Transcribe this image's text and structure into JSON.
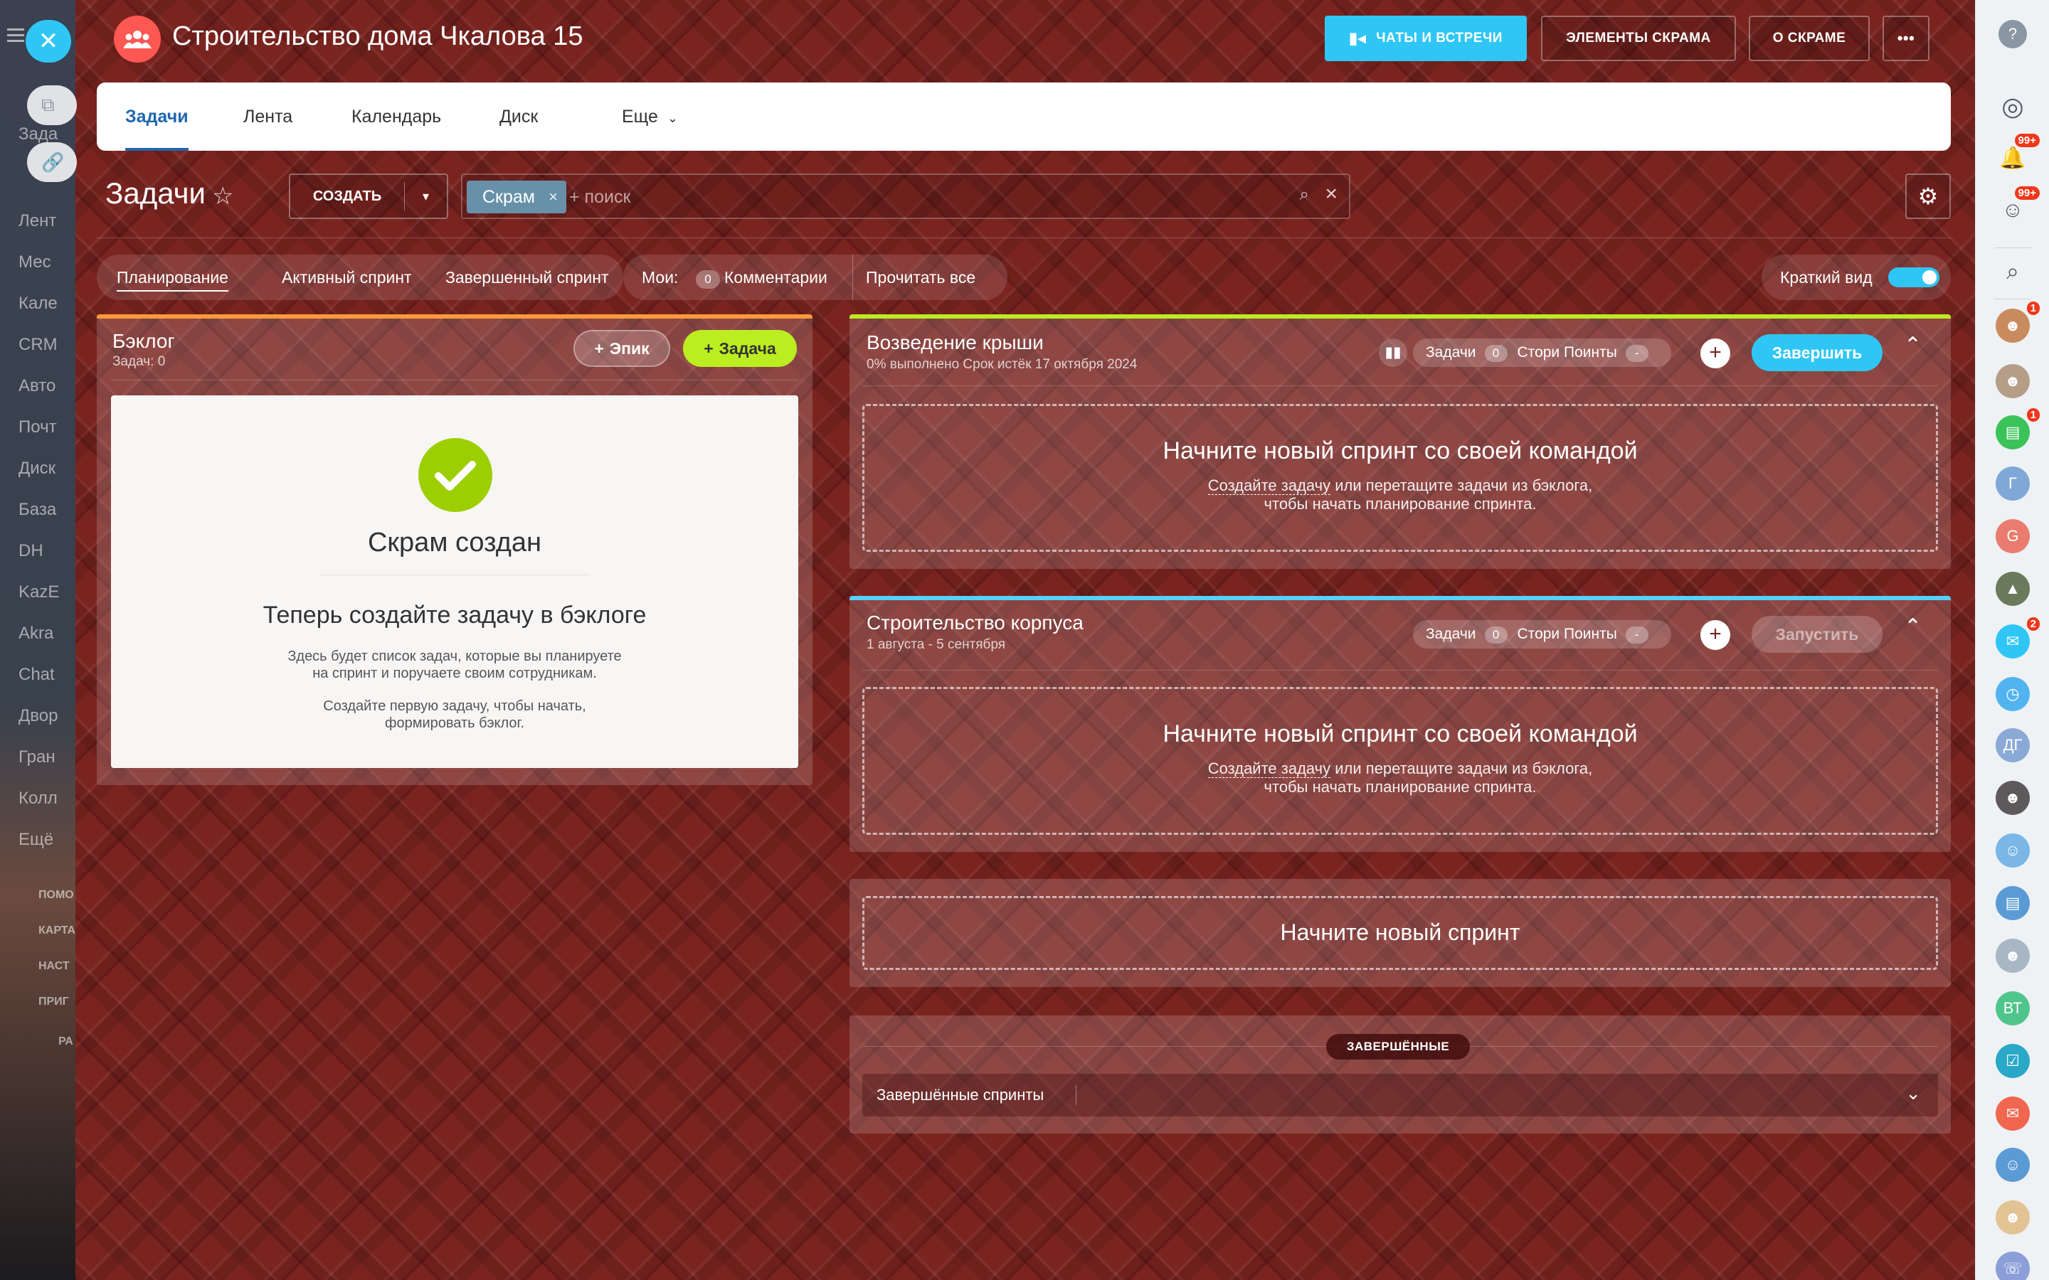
{
  "app": {
    "title": "Строительство дома Чкалова 15"
  },
  "header_buttons": {
    "chats": "ЧАТЫ И ВСТРЕЧИ",
    "scrum_elements": "ЭЛЕМЕНТЫ СКРАМА",
    "about_scrum": "О СКРАМЕ",
    "more": "•••"
  },
  "tabs": [
    {
      "label": "Задачи"
    },
    {
      "label": "Лента"
    },
    {
      "label": "Календарь"
    },
    {
      "label": "Диск"
    },
    {
      "label": "Еще"
    }
  ],
  "page": {
    "title": "Задачи",
    "create_label": "СОЗДАТЬ"
  },
  "search": {
    "tag": "Скрам",
    "placeholder": "+ поиск"
  },
  "filters": {
    "planning": "Планирование",
    "active_sprint": "Активный спринт",
    "completed_sprint": "Завершенный спринт",
    "mine_label": "Мои:",
    "comments_count": "0",
    "comments": "Комментарии",
    "read_all": "Прочитать все",
    "short_view": "Краткий вид"
  },
  "backlog": {
    "title": "Бэклог",
    "subtitle": "Задач: 0",
    "epic_btn": "Эпик",
    "task_btn": "Задача",
    "empty_title": "Скрам создан",
    "empty_heading": "Теперь создайте задачу в бэклоге",
    "empty_text1": "Здесь будет список задач, которые вы планируете",
    "empty_text2": "на спринт и поручаете своим сотрудникам.",
    "empty_text3": "Создайте первую задачу, чтобы начать,",
    "empty_text4": "формировать бэклог."
  },
  "sprints": [
    {
      "title": "Возведение крыши",
      "subtitle": "0% выполнено Срок истёк 17 октября 2024",
      "tasks_label": "Задачи",
      "tasks_count": "0",
      "points_label": "Стори Поинты",
      "points_value": "-",
      "action": "Завершить",
      "empty_title": "Начните новый спринт со своей командой",
      "empty_link": "Создайте задачу",
      "empty_text": " или перетащите задачи из бэклога,",
      "empty_text2": "чтобы начать планирование спринта."
    },
    {
      "title": "Строительство корпуса",
      "subtitle": "1 августа - 5 сентября",
      "tasks_label": "Задачи",
      "tasks_count": "0",
      "points_label": "Стори Поинты",
      "points_value": "-",
      "action": "Запустить",
      "empty_title": "Начните новый спринт со своей командой",
      "empty_link": "Создайте задачу",
      "empty_text": " или перетащите задачи из бэклога,",
      "empty_text2": "чтобы начать планирование спринта."
    }
  ],
  "new_sprint": "Начните новый спринт",
  "completed": {
    "badge": "ЗАВЕРШЁННЫЕ",
    "select_label": "Завершённые спринты"
  },
  "left_menu": [
    "Зада",
    "Лент",
    "Мес",
    "Кале",
    "CRM",
    "Авто",
    "Почт",
    "Диск",
    "База",
    "DH",
    "KazE",
    "Akra",
    "Chat",
    "Двор",
    "Гран",
    "Колл",
    "Ещё"
  ],
  "left_menu_small": [
    "ПОМО",
    "КАРТА",
    "НАСТ",
    "ПРИГ",
    "РА"
  ],
  "rightbar": {
    "badge_notifications": "99+",
    "badge_chat": "99+",
    "badge_1": "1",
    "badge_2": "1",
    "badge_3": "2",
    "avatar_g": "Г",
    "avatar_G": "G",
    "avatar_dg": "ДГ",
    "avatar_vt": "ВТ"
  },
  "colors": {
    "accent": "#2fc6f6",
    "task_btn": "#bbed21",
    "backlog_bar": "#ff9a3c",
    "sprint1_bar": "#bbed21",
    "sprint2_bar": "#55d0ff",
    "logo": "#ff5752"
  }
}
